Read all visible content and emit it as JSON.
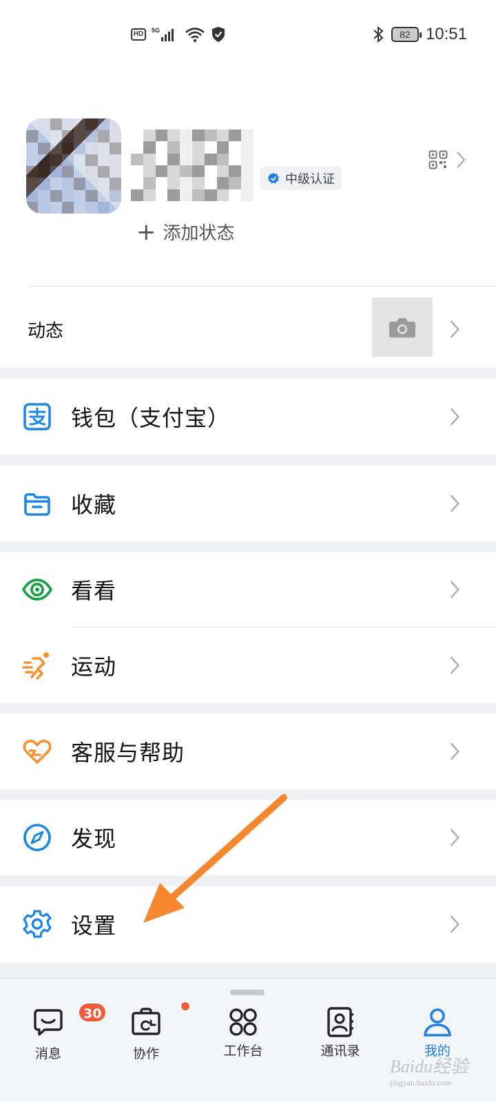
{
  "status_bar": {
    "network_badge": "HD",
    "signal_label": "5G",
    "battery": "82",
    "time": "10:51"
  },
  "profile": {
    "cert_label": "中级认证",
    "add_status_label": "添加状态"
  },
  "moments": {
    "label": "动态"
  },
  "menu": {
    "wallet": "钱包（支付宝）",
    "favorites": "收藏",
    "kan": "看看",
    "sport": "运动",
    "service": "客服与帮助",
    "discover": "发现",
    "settings": "设置"
  },
  "tabbar": {
    "messages": "消息",
    "messages_badge": "30",
    "collab": "协作",
    "workbench": "工作台",
    "contacts": "通讯录",
    "me": "我的"
  },
  "watermark": {
    "brand": "Baidu经验",
    "url": "jingyan.baidu.com"
  },
  "colors": {
    "accent_blue": "#1f7ee8",
    "alipay_blue": "#1a86e6",
    "green": "#1aa04a",
    "orange": "#f5922f",
    "badge_red": "#f15a3a",
    "arrow": "#f5872e"
  },
  "icons": {
    "wallet": "alipay-icon",
    "favorites": "folder-icon",
    "kan": "eye-icon",
    "sport": "running-icon",
    "service": "heart-hand-icon",
    "discover": "compass-icon",
    "settings": "gear-icon"
  }
}
